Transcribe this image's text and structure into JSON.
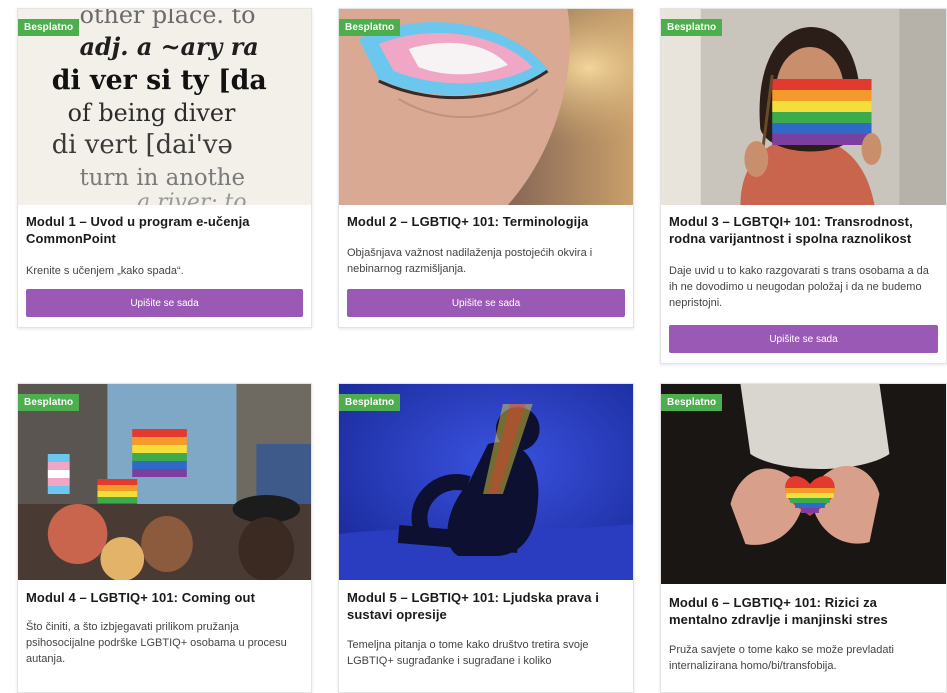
{
  "modules": [
    {
      "badge": "Besplatno",
      "title": "Modul 1 – Uvod u program e-učenja CommonPoint",
      "description": "Krenite s učenjem „kako spada“.",
      "button": "Upišite se sada",
      "image_text": [
        "other place. to",
        "adj. a ~ary ra",
        "di ver si ty [da",
        "of being diver",
        "di vert [dai'və",
        "turn in anothe",
        "a river: to"
      ]
    },
    {
      "badge": "Besplatno",
      "title": "Modul 2 – LGBTIQ+ 101: Terminologija",
      "description": "Objašnjava važnost nadilaženja postojećih okvira i nebinarnog razmišljanja.",
      "button": "Upišite se sada"
    },
    {
      "badge": "Besplatno",
      "title": "Modul 3 – LGBTQI+ 101: Transrodnost, rodna varijantnost i spolna raznolikost",
      "description": "Daje uvid u to kako razgovarati s trans osobama a da ih ne dovodimo u neugodan položaj i da ne budemo nepristojni.",
      "button": "Upišite se sada"
    },
    {
      "badge": "Besplatno",
      "title": "Modul 4 – LGBTIQ+ 101: Coming out",
      "description": "Što činiti, a što izbjegavati prilikom pružanja psihosocijalne podrške LGBTIQ+ osobama u procesu autanja."
    },
    {
      "badge": "Besplatno",
      "title": "Modul 5 – LGBTIQ+ 101: Ljudska prava i sustavi opresije",
      "description": "Temeljna pitanja o tome kako društvo tretira svoje LGBTIQ+ sugrađanke i sugrađane i koliko"
    },
    {
      "badge": "Besplatno",
      "title": "Modul 6 – LGBTIQ+ 101: Rizici za mentalno zdravlje i manjinski stres",
      "description": "Pruža savjete o tome kako se može prevladati internalizirana homo/bi/transfobija."
    }
  ],
  "colors": {
    "badge": "#4cae4c",
    "button": "#9b59b6"
  }
}
